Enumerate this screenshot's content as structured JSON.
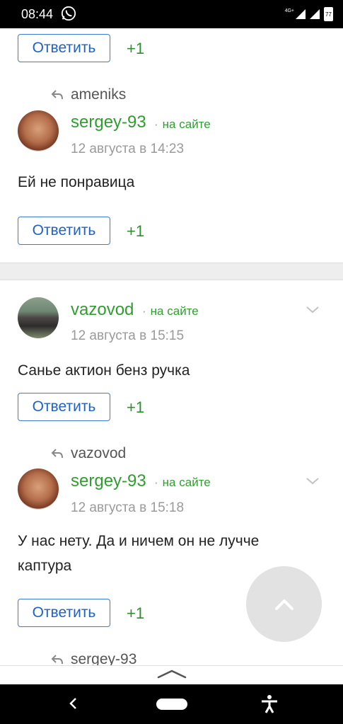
{
  "status": {
    "time": "08:44",
    "network": "4G+",
    "battery": "77"
  },
  "reply_label": "Ответить",
  "plus_one": "+1",
  "online_label": "на сайте",
  "comments": [
    {
      "reply_to": null,
      "username": null,
      "date": null,
      "text": null
    },
    {
      "reply_to": "ameniks",
      "username": "sergey-93",
      "date": "12 августа в 14:23",
      "text": "Ей не понравица"
    },
    {
      "reply_to": null,
      "username": "vazovod",
      "date": "12 августа в 15:15",
      "text": "Санье актион бенз ручка"
    },
    {
      "reply_to": "vazovod",
      "username": "sergey-93",
      "date": "12 августа в 15:18",
      "text": "У нас нету. Да и ничем он не лучче каптура"
    },
    {
      "reply_to": "sergey-93"
    }
  ]
}
